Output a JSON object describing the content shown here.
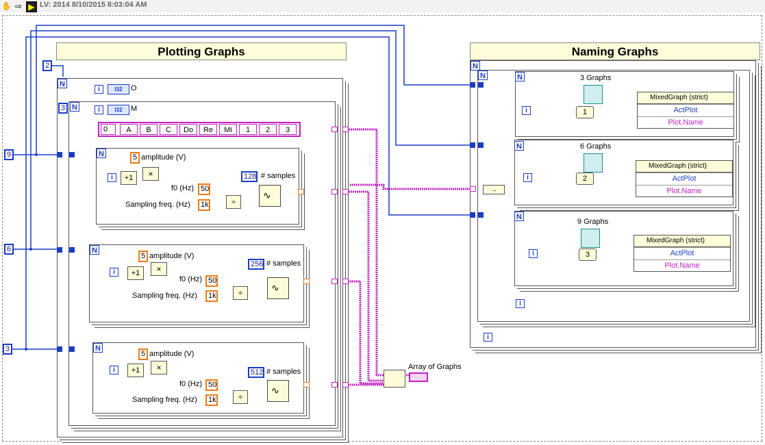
{
  "window": {
    "title": "LV: 2014 8/10/2015 8:03:04 AM"
  },
  "toolbar": {
    "icons": [
      "hand-icon",
      "arrow-right-icon",
      "labview-icon"
    ]
  },
  "decorations": {
    "left_title": "Plotting Graphs",
    "right_title": "Naming Graphs"
  },
  "left_diagram": {
    "outer_count": "2",
    "inner_count": "3",
    "indicator_O": "O",
    "indicator_M": "M",
    "i32_label": "I32",
    "string_array": {
      "index": "0",
      "items": [
        "A",
        "B",
        "C",
        "Do",
        "Re",
        "Mi",
        "1",
        "2",
        "3"
      ]
    },
    "row_inputs": [
      "9",
      "6",
      "3"
    ],
    "iteration_label": "i",
    "loop_label": "N",
    "blocks": [
      {
        "amplitude": "5",
        "amplitude_label": "amplitude (V)",
        "f0": "50",
        "f0_label": "f0 (Hz)",
        "fs": "1k",
        "fs_label": "Sampling freq. (Hz)",
        "samples": "128",
        "samples_label": "# samples"
      },
      {
        "amplitude": "5",
        "amplitude_label": "amplitude (V)",
        "f0": "50",
        "f0_label": "f0 (Hz)",
        "fs": "1k",
        "fs_label": "Sampling freq. (Hz)",
        "samples": "256",
        "samples_label": "# samples"
      },
      {
        "amplitude": "5",
        "amplitude_label": "amplitude (V)",
        "f0": "50",
        "f0_label": "f0 (Hz)",
        "fs": "1k",
        "fs_label": "Sampling freq. (Hz)",
        "samples": "512",
        "samples_label": "# samples"
      }
    ],
    "output_label": "Array of Graphs"
  },
  "right_diagram": {
    "graphs": [
      {
        "title": "3 Graphs",
        "index": "1",
        "node_header": "MixedGraph (strict)",
        "prop1": "ActPlot",
        "prop2": "Plot.Name"
      },
      {
        "title": "6 Graphs",
        "index": "2",
        "node_header": "MixedGraph (strict)",
        "prop1": "ActPlot",
        "prop2": "Plot.Name"
      },
      {
        "title": "9 Graphs",
        "index": "3",
        "node_header": "MixedGraph (strict)",
        "prop1": "ActPlot",
        "prop2": "Plot.Name"
      }
    ]
  },
  "colors": {
    "int_wire": "#1a3cc7",
    "dbl_wire": "#ea7b14",
    "string_wire": "#c020c0",
    "teal": "#1a8a8a"
  }
}
